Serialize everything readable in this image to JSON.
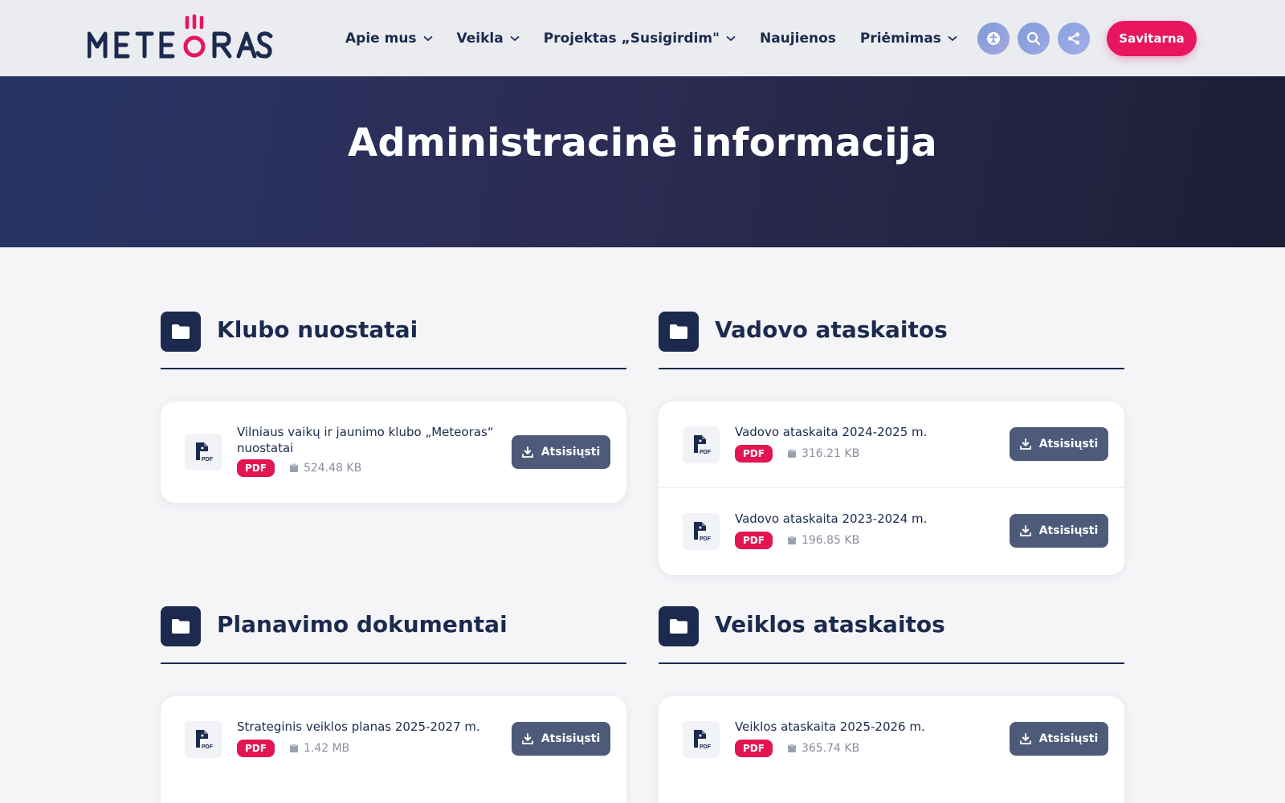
{
  "brand": {
    "name": "METEORAS",
    "accent": "#e8155f",
    "navy": "#1b2a4e"
  },
  "nav": [
    {
      "label": "Apie mus",
      "has_dropdown": true
    },
    {
      "label": "Veikla",
      "has_dropdown": true
    },
    {
      "label": "Projektas „Susigirdim\"",
      "has_dropdown": true
    },
    {
      "label": "Naujienos",
      "has_dropdown": false
    },
    {
      "label": "Priėmimas",
      "has_dropdown": true
    }
  ],
  "header_icons": [
    "accessibility-icon",
    "search-icon",
    "share-icon"
  ],
  "savitarna_label": "Savitarna",
  "hero": {
    "title": "Administracinė informacija"
  },
  "download_label": "Atsisiųsti",
  "sections": [
    {
      "title": "Klubo nuostatai",
      "docs": [
        {
          "name": "Vilniaus vaikų ir jaunimo klubo „Meteoras“ nuostatai",
          "type": "PDF",
          "size": "524.48 KB"
        }
      ]
    },
    {
      "title": "Vadovo ataskaitos",
      "docs": [
        {
          "name": "Vadovo ataskaita 2024-2025 m.",
          "type": "PDF",
          "size": "316.21 KB"
        },
        {
          "name": "Vadovo ataskaita 2023-2024 m.",
          "type": "PDF",
          "size": "196.85 KB"
        }
      ]
    },
    {
      "title": "Planavimo dokumentai",
      "docs": [
        {
          "name": "Strateginis veiklos planas 2025-2027 m.",
          "type": "PDF",
          "size": "1.42 MB"
        }
      ]
    },
    {
      "title": "Veiklos ataskaitos",
      "docs": [
        {
          "name": "Veiklos ataskaita 2025-2026 m.",
          "type": "PDF",
          "size": "365.74 KB"
        }
      ]
    }
  ]
}
